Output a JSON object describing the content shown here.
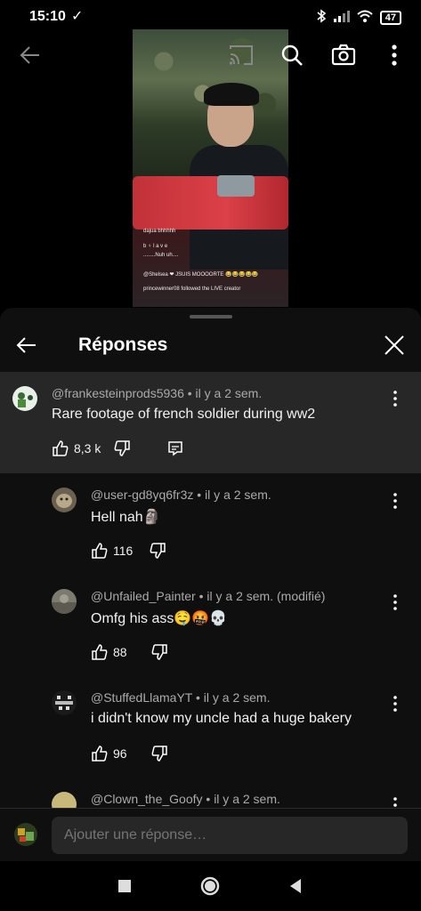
{
  "status_bar": {
    "time": "15:10",
    "check": "✓",
    "battery": "47"
  },
  "sheet": {
    "title": "Réponses",
    "parent": {
      "author": "@frankesteinprods5936",
      "age": "• il y a 2 sem.",
      "text": "Rare footage of french soldier during ww2",
      "likes": "8,3 k"
    },
    "replies": [
      {
        "author": "@user-gd8yq6fr3z",
        "age": "• il y a 2 sem.",
        "text": "Hell nah🗿",
        "likes": "116"
      },
      {
        "author": "@Unfailed_Painter",
        "age": "• il y a 2 sem. (modifié)",
        "text": "Omfg his ass🤤🤬💀",
        "likes": "88"
      },
      {
        "author": "@StuffedLlamaYT",
        "age": "• il y a 2 sem.",
        "text": "i didn't know my uncle had a huge bakery",
        "likes": "96"
      },
      {
        "author": "@Clown_the_Goofy",
        "age": "• il y a 2 sem."
      }
    ],
    "reply_placeholder": "Ajouter une réponse…"
  },
  "video_overlay": {
    "line1": "dajua bhhhhh",
    "line2": "b ♀ l a v e",
    "line3": "........Nuh uh....",
    "line4": "@Shelsea ❤ JSUIS MOOOORTE 😂😂😂😂😂",
    "line5": "princewinner08 followed the LIVE creator"
  },
  "colors": {
    "sheet_bg": "#0f0f0f",
    "parent_bg": "#272727",
    "meta": "#aaaaaa"
  }
}
